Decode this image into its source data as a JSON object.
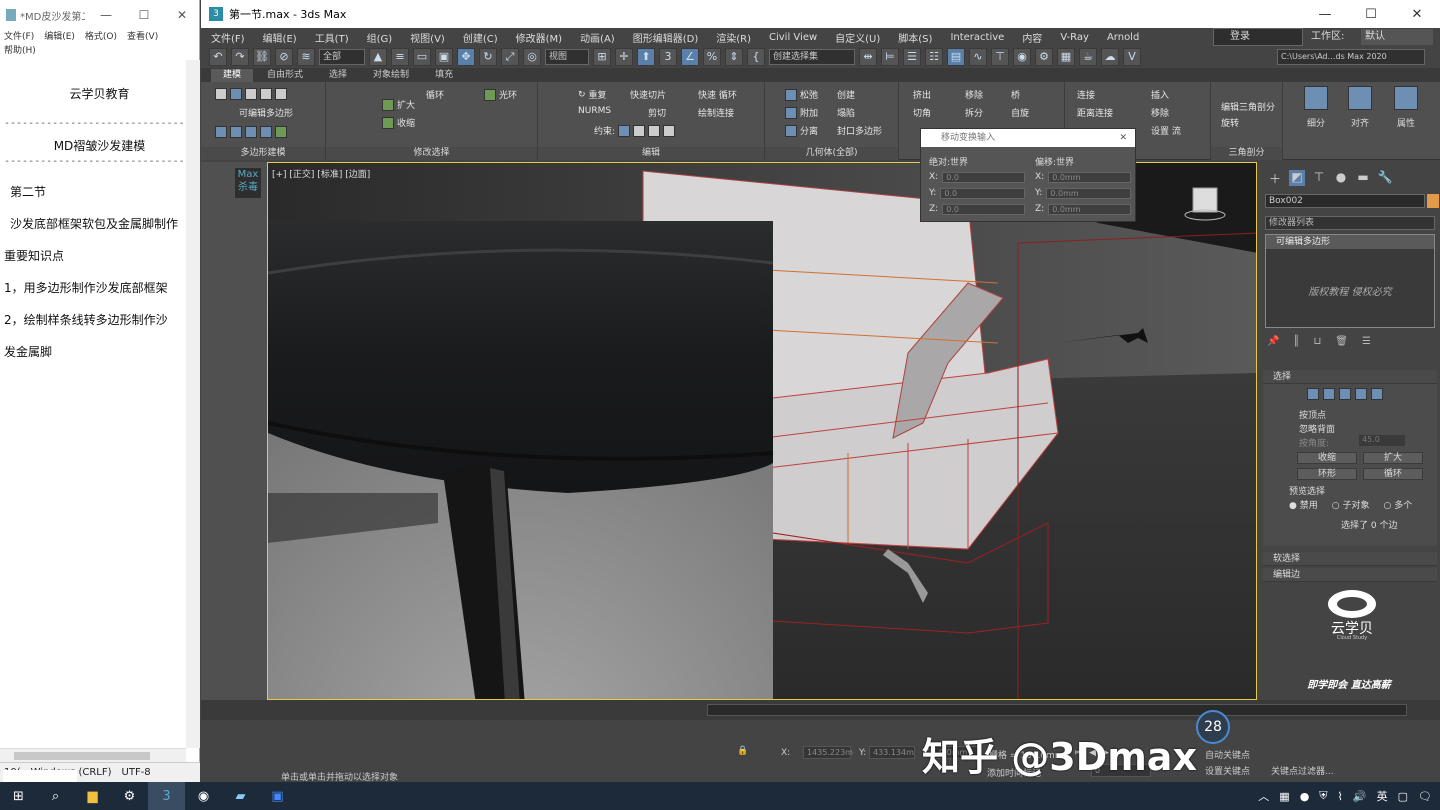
{
  "notepad": {
    "title": "*MD皮沙发第二...",
    "window_buttons": [
      "—",
      "☐",
      "✕"
    ],
    "menu": [
      "文件(F)",
      "编辑(E)",
      "格式(O)",
      "查看(V)",
      "帮助(H)"
    ],
    "lines": {
      "brand": "云学贝教育",
      "separator": "----------------------------------------",
      "course": "MD褶皱沙发建模",
      "section": "第二节",
      "topic": "沙发底部框架软包及金属脚制作",
      "key_points": "重要知识点",
      "point1": "1，用多边形制作沙发底部框架",
      "point2": "2，绘制样条线转多边形制作沙",
      "point2b": "发金属脚"
    },
    "status": {
      "zoom": "10(",
      "encoding_line": "Windows (CRLF)",
      "charset": "UTF-8"
    }
  },
  "max": {
    "title": "第一节.max - 3ds Max",
    "window_buttons": [
      "—",
      "☐",
      "✕"
    ],
    "menu": [
      "文件(F)",
      "编辑(E)",
      "工具(T)",
      "组(G)",
      "视图(V)",
      "创建(C)",
      "修改器(M)",
      "动画(A)",
      "图形编辑器(D)",
      "渲染(R)",
      "Civil View",
      "自定义(U)",
      "脚本(S)",
      "Interactive",
      "内容",
      "V-Ray",
      "Arnold"
    ],
    "login": "登录",
    "workspace_label": "工作区:",
    "workspace_value": "默认",
    "toolbar": {
      "selection_filter": "全部",
      "ref_coord": "视图",
      "named_sel": "创建选择集",
      "path": "C:\\Users\\Ad…ds Max 2020"
    },
    "ribbon_tabs": [
      "建模",
      "自由形式",
      "选择",
      "对象绘制",
      "填充"
    ],
    "ribbon": {
      "g1_label": "多边形建模",
      "g1_item": "可编辑多边形",
      "g2_label": "修改选择",
      "g2_items": [
        "扩大",
        "收缩",
        "循环",
        "光环"
      ],
      "g3_label": "编辑",
      "g3_items": [
        "重复",
        "快速切片",
        "快速 循环",
        "NURMS",
        "剪切",
        "绘制连接",
        "约束:"
      ],
      "g4_label": "几何体(全部)",
      "g4_items": [
        "松弛",
        "创建",
        "附加",
        "塌陷",
        "分离",
        "封口多边形"
      ],
      "g5_items": [
        "挤出",
        "移除",
        "桥",
        "切角",
        "拆分",
        "自旋"
      ],
      "g6_items": [
        "连接",
        "插入",
        "距离连接",
        "移除",
        "设置 流"
      ],
      "g7_label": "三角剖分",
      "g7_items": [
        "编辑三角剖分",
        "旋转"
      ],
      "big_buttons": [
        "细分",
        "对齐",
        "属性"
      ],
      "loop_suffix": "环"
    },
    "viewport_label": "[+] [正交] [标准] [边面]",
    "kill_label": "Max\n杀毒",
    "transform_dialog": {
      "title": "移动变换输入",
      "abs_label": "绝对:世界",
      "off_label": "偏移:世界",
      "axes": [
        "X:",
        "Y:",
        "Z:"
      ],
      "abs_values": [
        "0.0",
        "0.0",
        "0.0"
      ],
      "off_values": [
        "0.0mm",
        "0.0mm",
        "0.0mm"
      ]
    },
    "command_panel": {
      "object_name": "Box002",
      "modifier_list": "修改器列表",
      "stack_item": "可编辑多边形",
      "stack_watermark": "版权教程 侵权必究",
      "selection_title": "选择",
      "by_vertex": "按顶点",
      "ignore_back": "忽略背面",
      "by_angle": "按角度:",
      "angle_value": "45.0",
      "shrink": "收缩",
      "grow": "扩大",
      "ring": "环形",
      "loop": "循环",
      "preview_sel": "预览选择",
      "preview_opts": [
        "禁用",
        "子对象",
        "多个"
      ],
      "selected_info": "选择了 0 个边",
      "soft_sel": "软选择",
      "edit_edges": "编辑边",
      "logo_text": "云学贝",
      "logo_sub": "Cloud Study",
      "slogan": "即学即会 直达高薪"
    },
    "status": {
      "x_value": "1435.223m",
      "y_value": "433.134m",
      "z_value": "0.0mm",
      "grid": "栅格 = 100.0mm",
      "add_time_tag": "添加时间标记",
      "auto_key": "自动关键点",
      "set_key": "设置关键点",
      "key_filters": "关键点过滤器...",
      "frame": "0",
      "bottom_hint": "单击或单击并拖动以选择对象"
    }
  },
  "watermark": "知乎 @3Dmax",
  "fps": "28",
  "taskbar": {
    "tray_text": "英"
  }
}
